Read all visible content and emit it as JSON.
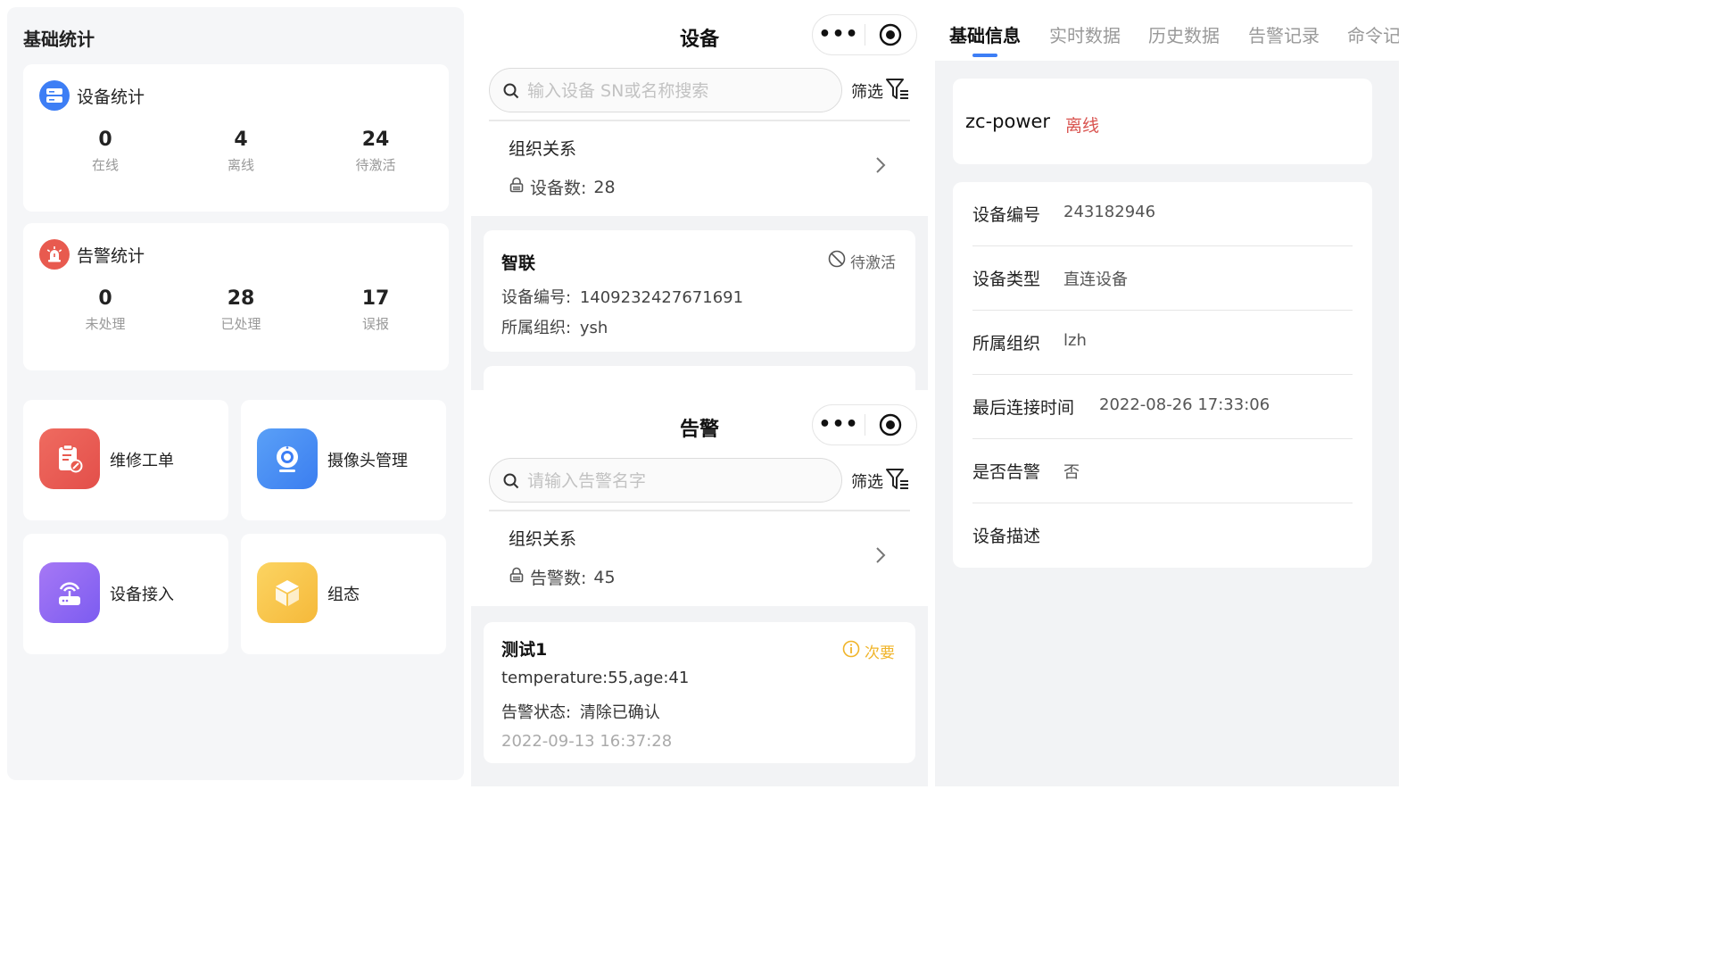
{
  "dashboard": {
    "title": "基础统计",
    "device_stats": {
      "label": "设备统计",
      "items": [
        {
          "value": "0",
          "caption": "在线"
        },
        {
          "value": "4",
          "caption": "离线"
        },
        {
          "value": "24",
          "caption": "待激活"
        }
      ]
    },
    "alarm_stats": {
      "label": "告警统计",
      "items": [
        {
          "value": "0",
          "caption": "未处理"
        },
        {
          "value": "28",
          "caption": "已处理"
        },
        {
          "value": "17",
          "caption": "误报"
        }
      ]
    },
    "apps": [
      {
        "label": "维修工单",
        "icon": "work-order-icon",
        "color": "#e85a4f"
      },
      {
        "label": "摄像头管理",
        "icon": "camera-icon",
        "color": "#3d7ef5"
      },
      {
        "label": "设备接入",
        "icon": "device-access-icon",
        "color": "#8b66f2"
      },
      {
        "label": "组态",
        "icon": "cube-icon",
        "color": "#f5c142"
      }
    ]
  },
  "devices": {
    "title": "设备",
    "search_placeholder": "输入设备 SN或名称搜索",
    "filter_label": "筛选",
    "org": {
      "title": "组织关系",
      "count_label": "设备数:",
      "count": "28"
    },
    "card": {
      "name": "智联",
      "status": "待激活",
      "serial_label": "设备编号:",
      "serial": "1409232427671691",
      "org_label": "所属组织:",
      "org": "ysh"
    }
  },
  "alarms": {
    "title": "告警",
    "search_placeholder": "请输入告警名字",
    "filter_label": "筛选",
    "org": {
      "title": "组织关系",
      "count_label": "告警数:",
      "count": "45"
    },
    "card": {
      "name": "测试1",
      "level": "次要",
      "detail": "temperature:55,age:41",
      "state_label": "告警状态:",
      "state": "清除已确认",
      "time": "2022-09-13 16:37:28"
    }
  },
  "detail": {
    "tabs": [
      "基础信息",
      "实时数据",
      "历史数据",
      "告警记录",
      "命令记"
    ],
    "device_name": "zc-power",
    "device_status": "离线",
    "status_color": "#d9534f",
    "rows": [
      {
        "key": "设备编号",
        "value": "243182946"
      },
      {
        "key": "设备类型",
        "value": "直连设备"
      },
      {
        "key": "所属组织",
        "value": "lzh"
      },
      {
        "key": "最后连接时间",
        "value": "2022-08-26 17:33:06"
      },
      {
        "key": "是否告警",
        "value": "否"
      },
      {
        "key": "设备描述",
        "value": ""
      }
    ]
  }
}
